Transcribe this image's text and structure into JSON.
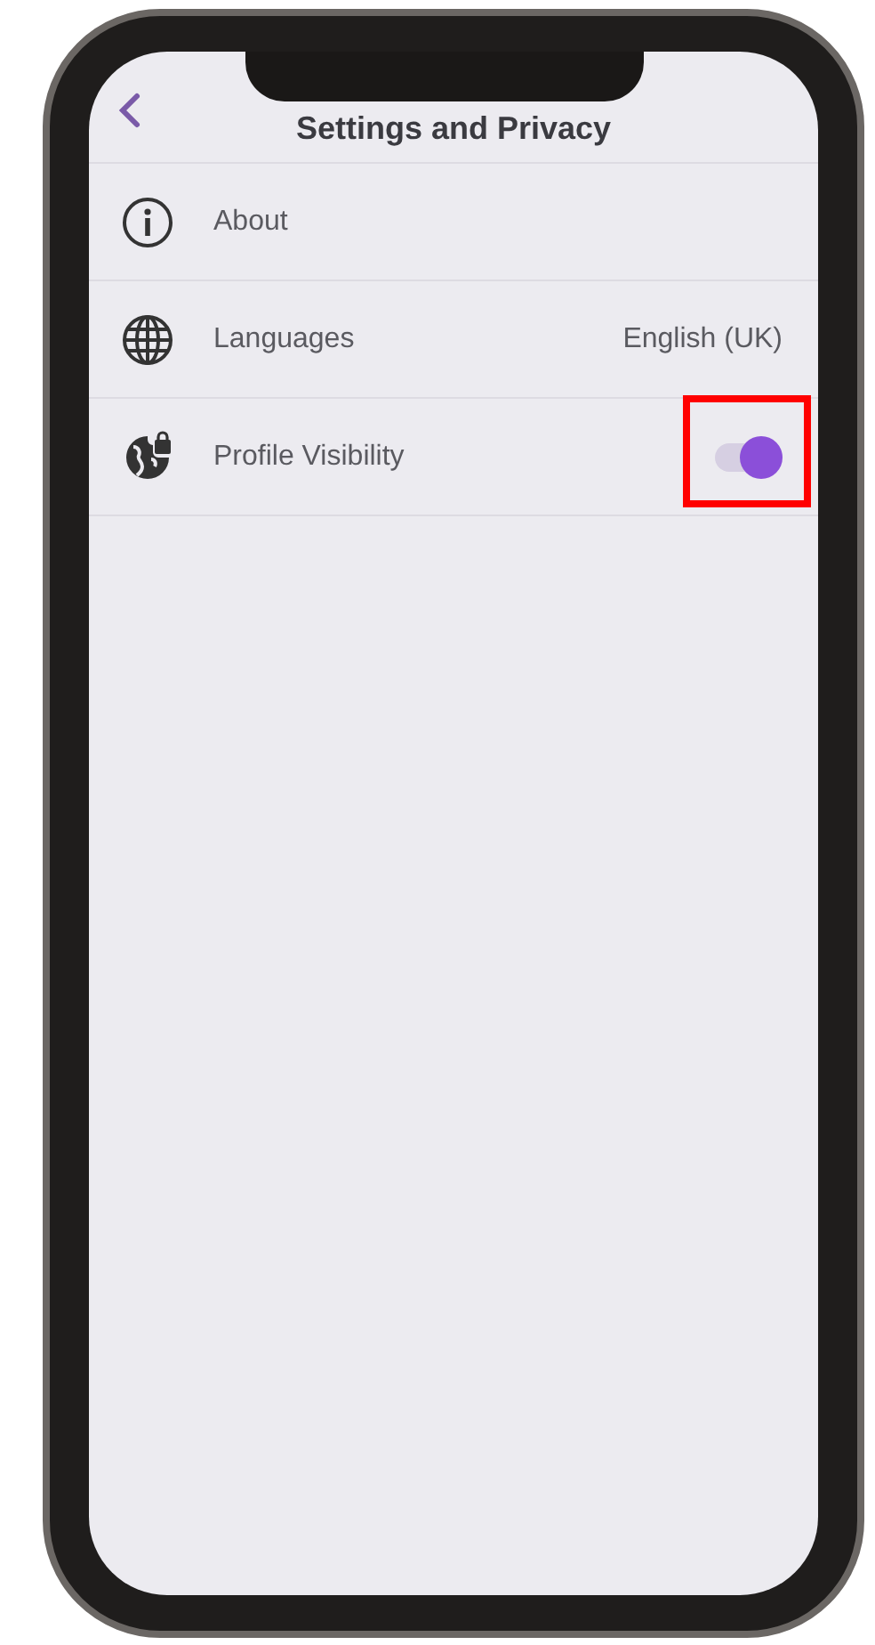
{
  "header": {
    "title": "Settings and Privacy"
  },
  "items": [
    {
      "kind": "link",
      "label": "About"
    },
    {
      "kind": "value",
      "label": "Languages",
      "value": "English (UK)"
    },
    {
      "kind": "toggle",
      "label": "Profile Visibility",
      "on": true,
      "highlighted": true
    }
  ]
}
